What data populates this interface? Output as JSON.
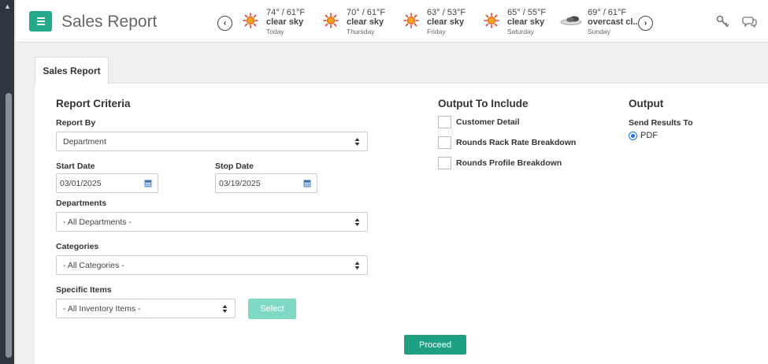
{
  "header": {
    "title": "Sales Report",
    "weather": [
      {
        "temp": "74° / 61°F",
        "condition": "clear sky",
        "day": "Today",
        "icon": "sun-icon"
      },
      {
        "temp": "70° / 61°F",
        "condition": "clear sky",
        "day": "Thursday",
        "icon": "sun-icon"
      },
      {
        "temp": "63° / 53°F",
        "condition": "clear sky",
        "day": "Friday",
        "icon": "sun-icon"
      },
      {
        "temp": "65° / 55°F",
        "condition": "clear sky",
        "day": "Saturday",
        "icon": "sun-icon"
      },
      {
        "temp": "69° / 61°F",
        "condition": "overcast cl...",
        "day": "Sunday",
        "icon": "cloud-icon"
      }
    ],
    "prev_arrow": "‹",
    "next_arrow": "›"
  },
  "tabs": [
    {
      "label": "Sales Report"
    }
  ],
  "criteria": {
    "title": "Report Criteria",
    "report_by": {
      "label": "Report By",
      "value": "Department"
    },
    "start_date": {
      "label": "Start Date",
      "value": "03/01/2025"
    },
    "stop_date": {
      "label": "Stop Date",
      "value": "03/19/2025"
    },
    "departments": {
      "label": "Departments",
      "value": "- All Departments -"
    },
    "categories": {
      "label": "Categories",
      "value": "- All Categories -"
    },
    "specific_items": {
      "label": "Specific Items",
      "value": "- All Inventory Items -"
    },
    "select_button": "Select"
  },
  "output_include": {
    "title": "Output To Include",
    "options": [
      {
        "label": "Customer Detail",
        "checked": false
      },
      {
        "label": "Rounds Rack Rate Breakdown",
        "checked": false
      },
      {
        "label": "Rounds Profile Breakdown",
        "checked": false
      }
    ]
  },
  "output": {
    "title": "Output",
    "send_label": "Send Results To",
    "radio_label": "PDF",
    "radio_selected": true
  },
  "proceed_button": "Proceed",
  "colors": {
    "accent": "#25a98b",
    "proceed": "#1fa083",
    "select_btn": "#7fd9c2",
    "sun": "#e8401c"
  }
}
